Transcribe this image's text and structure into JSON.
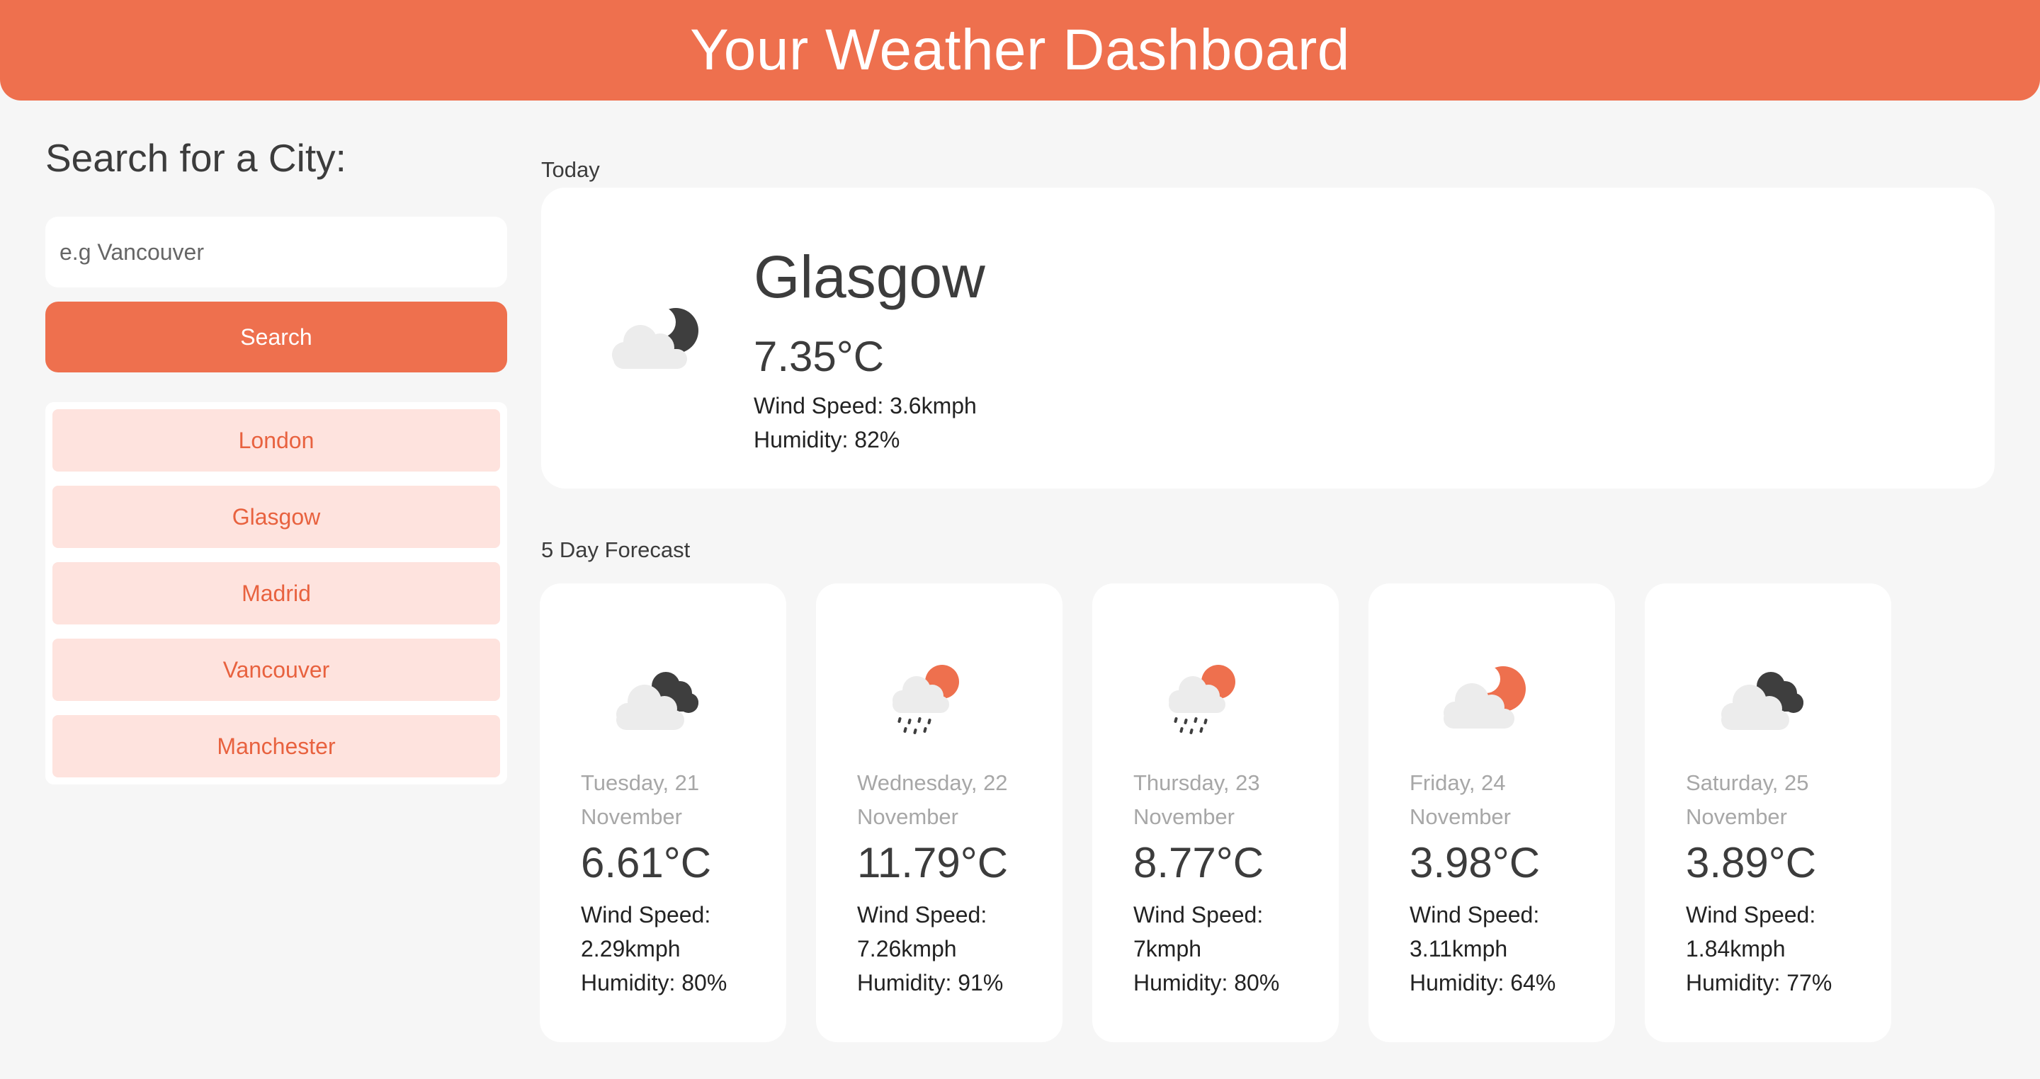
{
  "header": {
    "title": "Your Weather Dashboard"
  },
  "sidebar": {
    "heading": "Search for a City:",
    "search_placeholder": "e.g Vancouver",
    "search_button": "Search",
    "history": [
      {
        "label": "London"
      },
      {
        "label": "Glasgow"
      },
      {
        "label": "Madrid"
      },
      {
        "label": "Vancouver"
      },
      {
        "label": "Manchester"
      }
    ]
  },
  "today": {
    "section_label": "Today",
    "city": "Glasgow",
    "temp": "7.35°C",
    "wind": "Wind Speed: 3.6kmph",
    "humidity": "Humidity: 82%",
    "icon": "cloud-night-icon"
  },
  "forecast": {
    "section_label": "5 Day Forecast",
    "days": [
      {
        "date": "Tuesday, 21 November",
        "temp": "6.61°C",
        "wind_label": "Wind Speed:",
        "wind_value": "2.29kmph",
        "humidity": "Humidity: 80%",
        "icon": "broken-clouds-icon"
      },
      {
        "date": "Wednesday, 22 November",
        "temp": "11.79°C",
        "wind_label": "Wind Speed:",
        "wind_value": "7.26kmph",
        "humidity": "Humidity: 91%",
        "icon": "rain-sun-icon"
      },
      {
        "date": "Thursday, 23 November",
        "temp": "8.77°C",
        "wind_label": "Wind Speed:",
        "wind_value": "7kmph",
        "humidity": "Humidity: 80%",
        "icon": "rain-sun-icon"
      },
      {
        "date": "Friday, 24 November",
        "temp": "3.98°C",
        "wind_label": "Wind Speed:",
        "wind_value": "3.11kmph",
        "humidity": "Humidity: 64%",
        "icon": "partly-cloudy-icon"
      },
      {
        "date": "Saturday, 25 November",
        "temp": "3.89°C",
        "wind_label": "Wind Speed:",
        "wind_value": "1.84kmph",
        "humidity": "Humidity: 77%",
        "icon": "broken-clouds-icon"
      }
    ]
  },
  "colors": {
    "accent": "#ee704e",
    "history_bg": "#fee3de",
    "history_text": "#e8623f",
    "page_bg": "#f6f6f6",
    "cloud_light": "#ececec",
    "cloud_dark": "#3e3e3e"
  }
}
